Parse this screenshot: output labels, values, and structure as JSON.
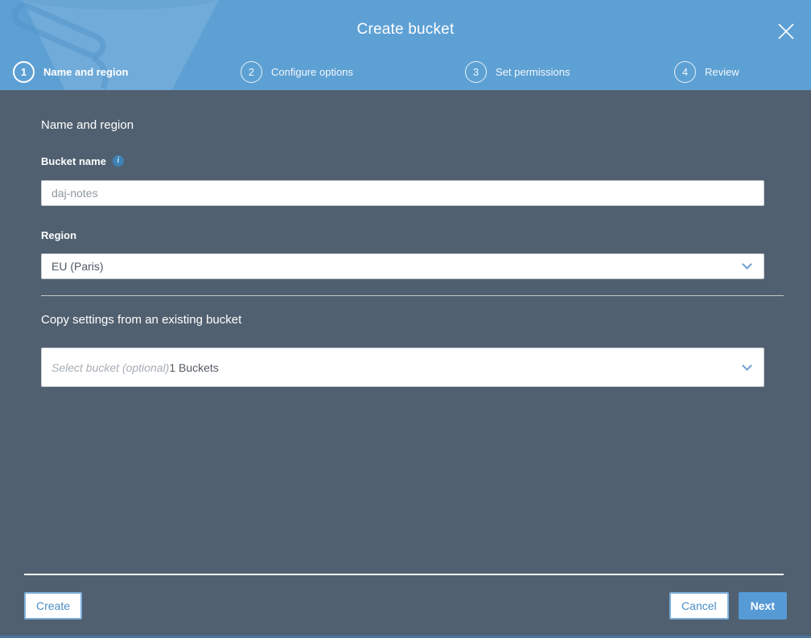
{
  "modal": {
    "title": "Create bucket",
    "close_glyph": "✕"
  },
  "steps": [
    {
      "number": "1",
      "label": "Name and region",
      "active": true
    },
    {
      "number": "2",
      "label": "Configure options",
      "active": false
    },
    {
      "number": "3",
      "label": "Set permissions",
      "active": false
    },
    {
      "number": "4",
      "label": "Review",
      "active": false
    }
  ],
  "form": {
    "section_heading": "Name and region",
    "bucket_name": {
      "label": "Bucket name",
      "info_glyph": "i",
      "value": "daj-notes"
    },
    "region": {
      "label": "Region",
      "selected": "EU (Paris)"
    },
    "copy_settings": {
      "heading": "Copy settings from an existing bucket",
      "placeholder": "Select bucket (optional)",
      "count_text": "1 Buckets"
    }
  },
  "footer": {
    "create_label": "Create",
    "cancel_label": "Cancel",
    "next_label": "Next"
  },
  "colors": {
    "header_blue": "#5da0d4",
    "body_slate": "#506070",
    "accent_blue": "#4a8ec6",
    "primary_button_blue": "#569ad6",
    "bottom_strip_blue": "#47759d"
  }
}
